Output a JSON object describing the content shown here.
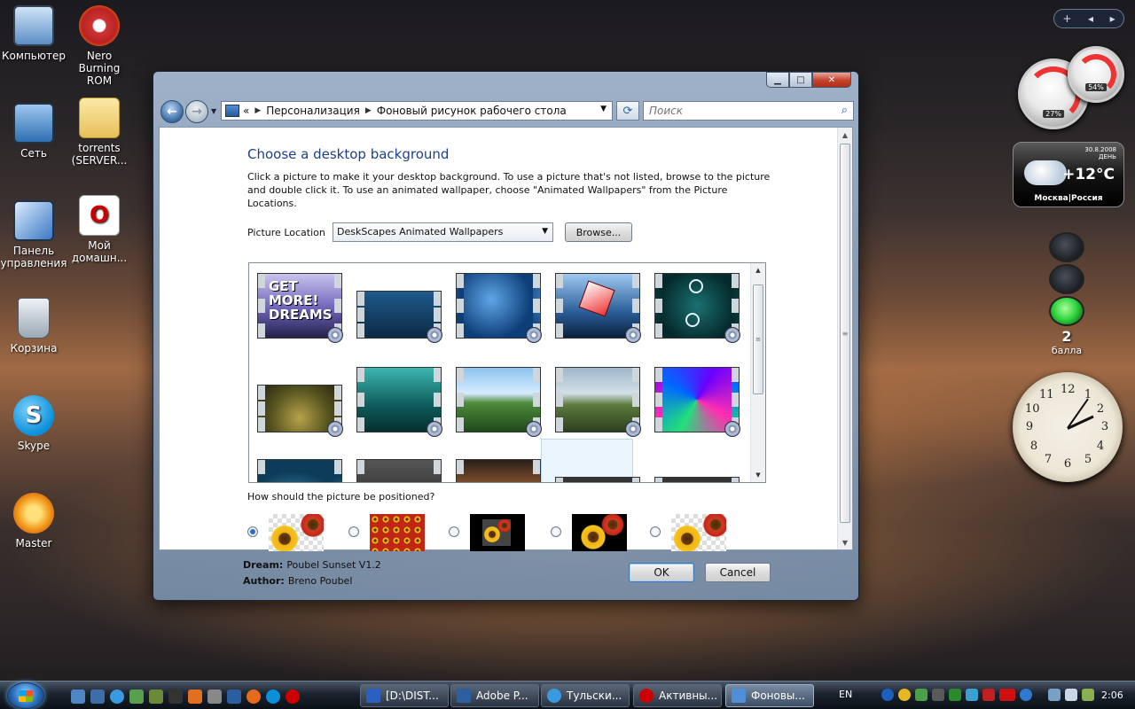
{
  "desktop": {
    "icons": [
      {
        "label": "Компьютер",
        "icon": "computer-icon"
      },
      {
        "label": "Nero Burning ROM",
        "icon": "nero-icon"
      },
      {
        "label": "Сеть",
        "icon": "network-icon"
      },
      {
        "label": "torrents (SERVER...",
        "icon": "folder-icon"
      },
      {
        "label": "Панель управления",
        "icon": "control-panel-icon"
      },
      {
        "label": "Мой домашн...",
        "icon": "opera-shortcut-icon"
      },
      {
        "label": "Корзина",
        "icon": "recycle-bin-icon"
      },
      {
        "label": "Skype",
        "icon": "skype-icon"
      },
      {
        "label": "Master",
        "icon": "master-icon"
      }
    ]
  },
  "gadgets": {
    "cpu_pct": "27%",
    "mem_pct": "54%",
    "weather": {
      "date": "30.8.2008",
      "daypart": "ДЕНЬ",
      "temp": "+12°C",
      "city": "Москва|Россия"
    },
    "traffic": {
      "score": "2",
      "label": "балла"
    },
    "clock_numbers": [
      "12",
      "1",
      "2",
      "3",
      "4",
      "5",
      "6",
      "7",
      "8",
      "9",
      "10",
      "11"
    ]
  },
  "window": {
    "breadcrumb": [
      "Персонализация",
      "Фоновый рисунок рабочего стола"
    ],
    "breadcrumb_prefix": "«",
    "search_placeholder": "Поиск",
    "heading": "Choose a desktop background",
    "description": "Click a picture to make it your desktop background. To use a picture that's not listed, browse to the picture and double click it. To use an animated wallpaper, choose \"Animated Wallpapers\" from the Picture Locations.",
    "picture_location_label": "Picture Location",
    "picture_location_value": "DeskScapes Animated Wallpapers",
    "browse_label": "Browse...",
    "first_tile_caption": "GET MORE! DREAMS",
    "position_question": "How should the picture be positioned?",
    "dream_label": "Dream:",
    "dream_value": "Poubel Sunset V1.2",
    "author_label": "Author:",
    "author_value": "Breno Poubel",
    "ok_label": "OK",
    "cancel_label": "Cancel"
  },
  "taskbar": {
    "tasks": [
      "[D:\\DIST...",
      "Adobe P...",
      "Тульски...",
      "Активны...",
      "Фоновы..."
    ],
    "language": "EN",
    "time": "2:06"
  }
}
